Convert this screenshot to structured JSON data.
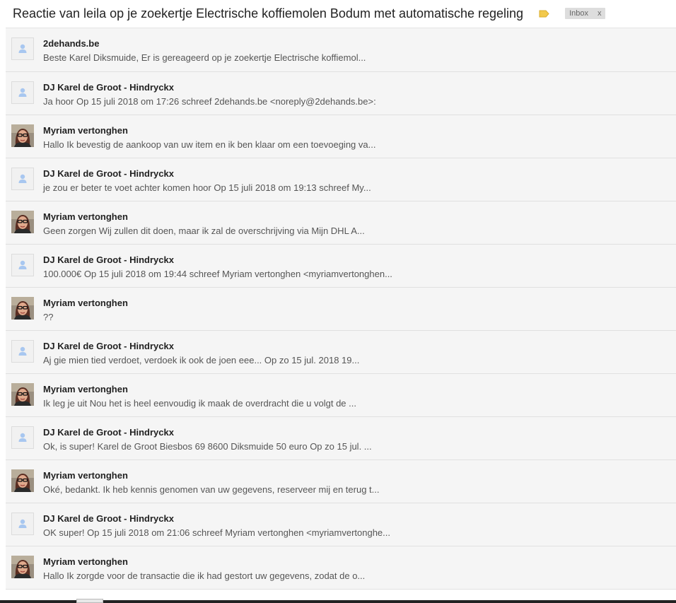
{
  "header": {
    "subject": "Reactie van leila op je zoekertje Electrische koffiemolen Bodum met automatische regeling",
    "label_icon": "label-icon",
    "label_color": "#f2c94c",
    "inbox_chip": {
      "label": "Inbox",
      "close": "x"
    }
  },
  "messages": [
    {
      "sender": "2dehands.be",
      "snippet": "Beste Karel Diksmuide, Er is gereageerd op je zoekertje Electrische koffiemol...",
      "avatar": "default"
    },
    {
      "sender": "DJ Karel de Groot - Hindryckx",
      "snippet": "Ja hoor Op 15 juli 2018 om 17:26 schreef 2dehands.be <noreply@2dehands.be>:",
      "avatar": "default"
    },
    {
      "sender": "Myriam vertonghen",
      "snippet": "Hallo Ik bevestig de aankoop van uw item en ik ben klaar om een toevoeging va...",
      "avatar": "photo"
    },
    {
      "sender": "DJ Karel de Groot - Hindryckx",
      "snippet": "je zou er beter te voet achter komen hoor Op 15 juli 2018 om 19:13 schreef My...",
      "avatar": "default"
    },
    {
      "sender": "Myriam vertonghen",
      "snippet": "Geen zorgen Wij zullen dit doen, maar ik zal de overschrijving via Mijn DHL A...",
      "avatar": "photo"
    },
    {
      "sender": "DJ Karel de Groot - Hindryckx",
      "snippet": "100.000€ Op 15 juli 2018 om 19:44 schreef Myriam vertonghen <myriamvertonghen...",
      "avatar": "default"
    },
    {
      "sender": "Myriam vertonghen",
      "snippet": "??",
      "avatar": "photo"
    },
    {
      "sender": "DJ Karel de Groot - Hindryckx",
      "snippet": "Aj gie mien tied verdoet, verdoek ik ook de joen eee... Op zo 15 jul. 2018 19...",
      "avatar": "default"
    },
    {
      "sender": "Myriam vertonghen",
      "snippet": "Ik leg je uit Nou het is heel eenvoudig ik maak de overdracht die u volgt de ...",
      "avatar": "photo"
    },
    {
      "sender": "DJ Karel de Groot - Hindryckx",
      "snippet": "Ok, is super! Karel de Groot Biesbos 69 8600 Diksmuide 50 euro Op zo 15 jul. ...",
      "avatar": "default"
    },
    {
      "sender": "Myriam vertonghen",
      "snippet": "Oké, bedankt. Ik heb kennis genomen van uw gegevens, reserveer mij en terug t...",
      "avatar": "photo"
    },
    {
      "sender": "DJ Karel de Groot - Hindryckx",
      "snippet": "OK super! Op 15 juli 2018 om 21:06 schreef Myriam vertonghen <myriamvertonghe...",
      "avatar": "default"
    },
    {
      "sender": "Myriam vertonghen",
      "snippet": "Hallo Ik zorgde voor de transactie die ik had gestort uw gegevens, zodat de o...",
      "avatar": "photo"
    }
  ]
}
